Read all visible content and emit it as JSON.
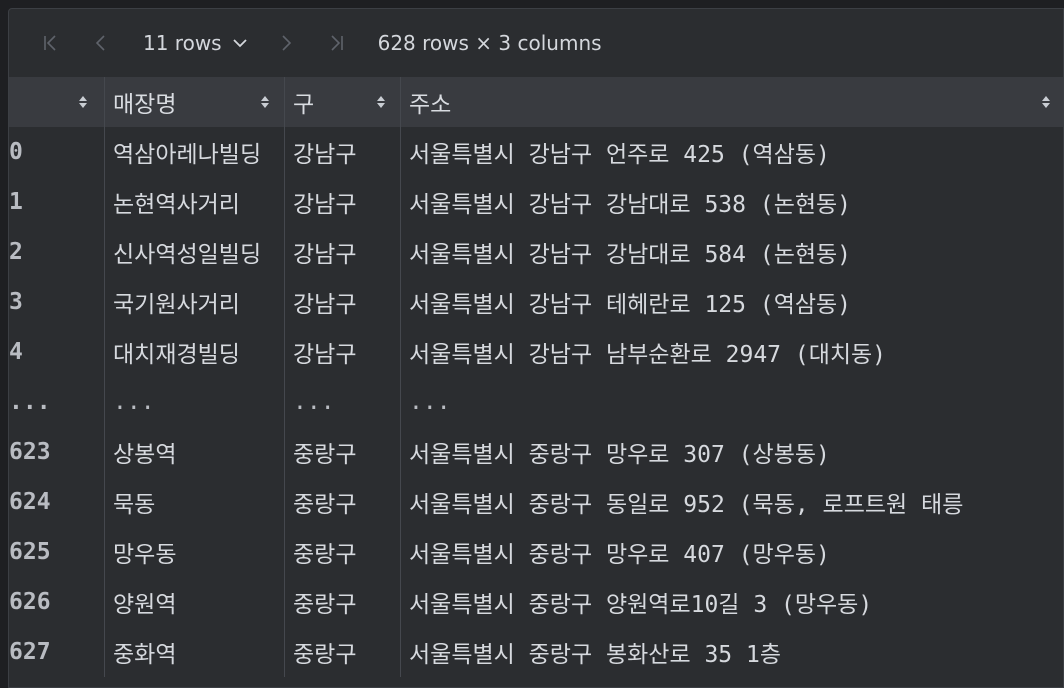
{
  "toolbar": {
    "rows_label": "11 rows",
    "shape_label": "628 rows × 3 columns"
  },
  "table": {
    "columns": [
      "",
      "매장명",
      "구",
      "주소"
    ],
    "rows": [
      [
        "0",
        "역삼아레나빌딩",
        "강남구",
        "서울특별시 강남구 언주로 425 (역삼동)"
      ],
      [
        "1",
        "논현역사거리",
        "강남구",
        "서울특별시 강남구 강남대로 538 (논현동)"
      ],
      [
        "2",
        "신사역성일빌딩",
        "강남구",
        "서울특별시 강남구 강남대로 584 (논현동)"
      ],
      [
        "3",
        "국기원사거리",
        "강남구",
        "서울특별시 강남구 테헤란로 125 (역삼동)"
      ],
      [
        "4",
        "대치재경빌딩",
        "강남구",
        "서울특별시 강남구 남부순환로 2947 (대치동)"
      ],
      [
        "...",
        "...",
        "...",
        "..."
      ],
      [
        "623",
        "상봉역",
        "중랑구",
        "서울특별시 중랑구 망우로 307 (상봉동)"
      ],
      [
        "624",
        "묵동",
        "중랑구",
        "서울특별시 중랑구 동일로 952 (묵동, 로프트원 태릉"
      ],
      [
        "625",
        "망우동",
        "중랑구",
        "서울특별시 중랑구 망우로 407 (망우동)"
      ],
      [
        "626",
        "양원역",
        "중랑구",
        "서울특별시 중랑구 양원역로10길 3 (망우동)"
      ],
      [
        "627",
        "중화역",
        "중랑구",
        "서울특별시 중랑구 봉화산로 35 1층"
      ]
    ]
  }
}
